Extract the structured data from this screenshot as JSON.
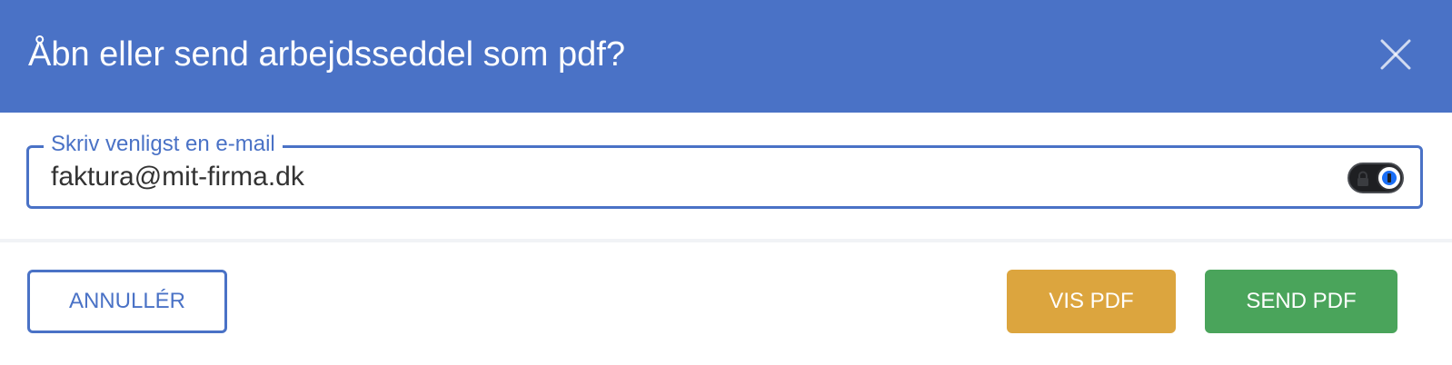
{
  "dialog": {
    "title": "Åbn eller send arbejdsseddel som pdf?",
    "close_icon": "close-icon",
    "email_field": {
      "label": "Skriv venligst en e-mail",
      "value": "faktura@mit-firma.dk",
      "password_manager_icon": "password-manager-icon"
    },
    "buttons": {
      "cancel": "ANNULLÉR",
      "view_pdf": "VIS PDF",
      "send_pdf": "SEND PDF"
    },
    "colors": {
      "header": "#4a72c6",
      "accent": "#4a72c6",
      "view_button": "#dca53e",
      "send_button": "#4aa45b"
    }
  }
}
